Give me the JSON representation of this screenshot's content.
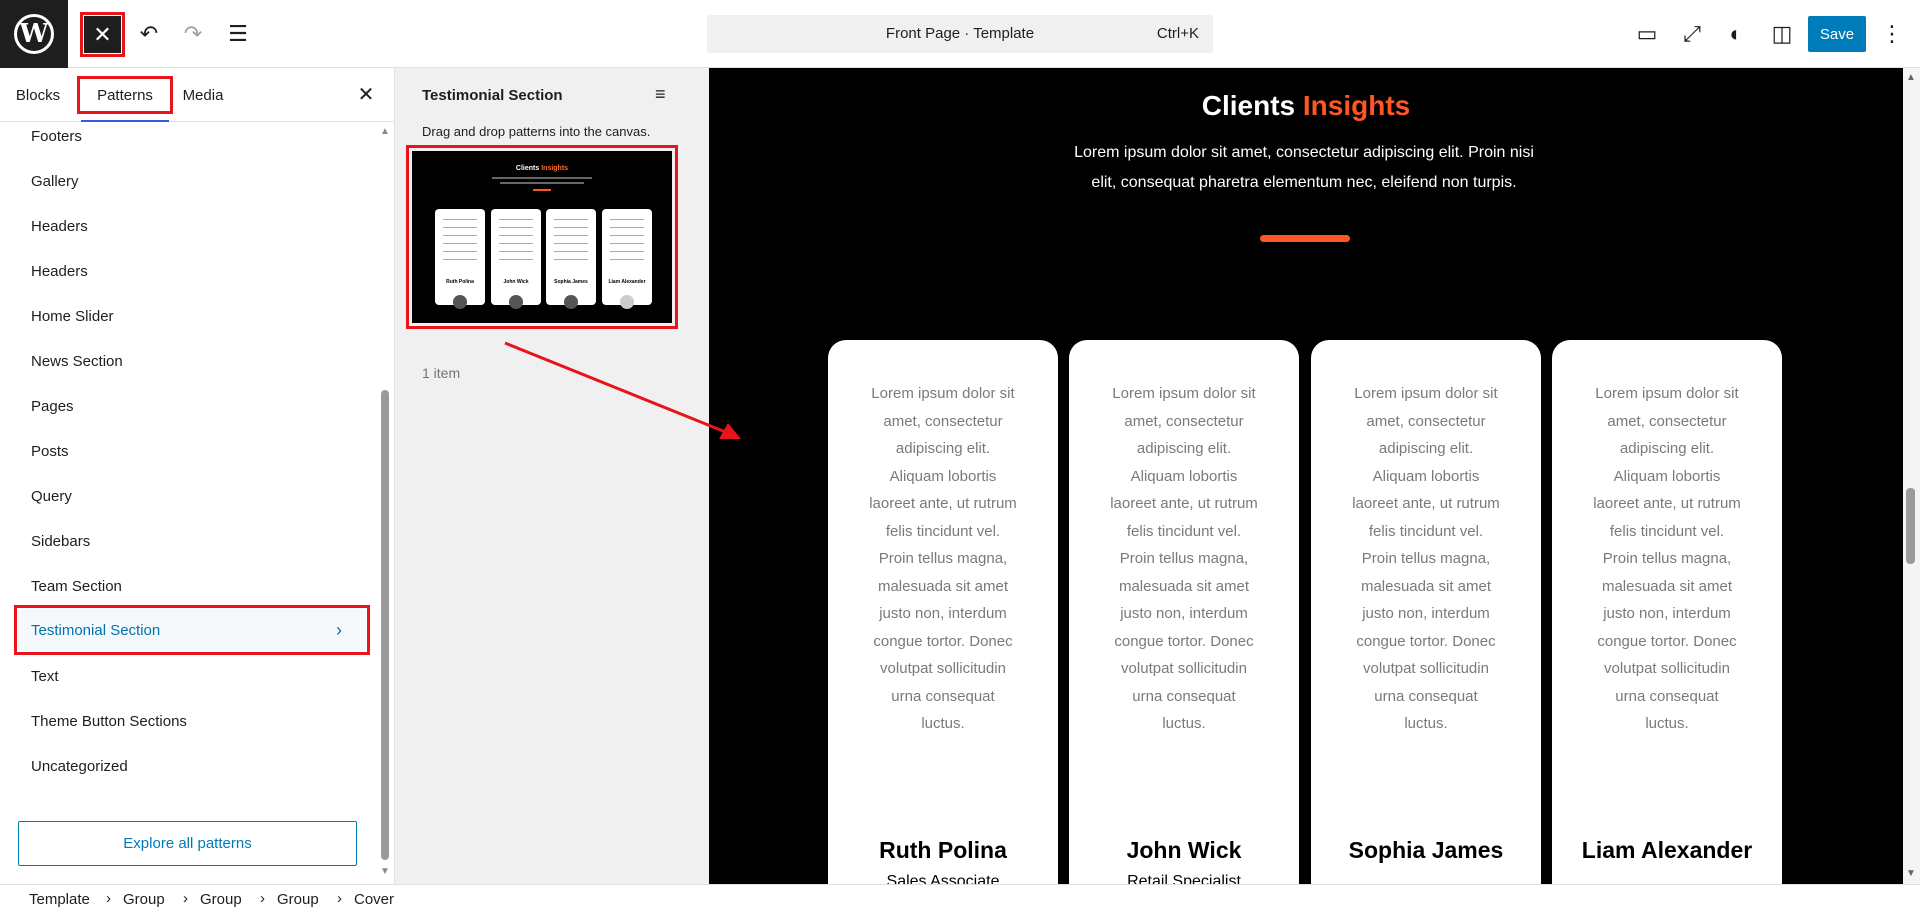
{
  "topbar": {
    "logo": "W",
    "close_glyph": "✕",
    "undo_glyph": "↶",
    "redo_glyph": "↷",
    "list_view_glyph": "☰",
    "document_title": "Front Page · Template",
    "shortcut": "Ctrl+K",
    "view_glyph": "▭",
    "fullscreen_glyph": "⤢",
    "styles_glyph": "◐",
    "settings_glyph": "◫",
    "save_label": "Save",
    "options_glyph": "⋮"
  },
  "inserter": {
    "tabs": [
      {
        "label": "Blocks"
      },
      {
        "label": "Patterns"
      },
      {
        "label": "Media"
      }
    ],
    "close_glyph": "✕",
    "categories": [
      "Footers",
      "Gallery",
      "Headers",
      "Headers",
      "Home Slider",
      "News Section",
      "Pages",
      "Posts",
      "Query",
      "Sidebars",
      "Team Section",
      "Testimonial Section",
      "Text",
      "Theme Button Sections",
      "Uncategorized"
    ],
    "selected_category_chevron": "›",
    "explore_label": "Explore all patterns"
  },
  "pattern_panel": {
    "title": "Testimonial Section",
    "filter_glyph": "≡",
    "hint": "Drag and drop patterns into the canvas.",
    "thumb_title_a": "Clients",
    "thumb_title_b": "Insights",
    "thumb_names": [
      "Ruth Polina",
      "John Wick",
      "Sophia James",
      "Liam Alexander"
    ],
    "count": "1 item"
  },
  "canvas": {
    "title_a": "Clients",
    "title_b": "Insights",
    "subtitle": "Lorem ipsum dolor sit amet, consectetur adipiscing elit. Proin nisi elit, consequat pharetra elementum nec, eleifend non turpis.",
    "cards": [
      {
        "quote": "Lorem ipsum dolor sit amet, consectetur adipiscing elit. Aliquam lobortis laoreet ante, ut rutrum felis tincidunt vel. Proin tellus magna, malesuada sit amet justo non, interdum congue tortor. Donec volutpat sollicitudin urna consequat luctus.",
        "name": "Ruth Polina",
        "role": "Sales Associate"
      },
      {
        "quote": "Lorem ipsum dolor sit amet, consectetur adipiscing elit. Aliquam lobortis laoreet ante, ut rutrum felis tincidunt vel. Proin tellus magna, malesuada sit amet justo non, interdum congue tortor. Donec volutpat sollicitudin urna consequat luctus.",
        "name": "John Wick",
        "role": "Retail Specialist"
      },
      {
        "quote": "Lorem ipsum dolor sit amet, consectetur adipiscing elit. Aliquam lobortis laoreet ante, ut rutrum felis tincidunt vel. Proin tellus magna, malesuada sit amet justo non, interdum congue tortor. Donec volutpat sollicitudin urna consequat luctus.",
        "name": "Sophia James",
        "role": ""
      },
      {
        "quote": "Lorem ipsum dolor sit amet, consectetur adipiscing elit. Aliquam lobortis laoreet ante, ut rutrum felis tincidunt vel. Proin tellus magna, malesuada sit amet justo non, interdum congue tortor. Donec volutpat sollicitudin urna consequat luctus.",
        "name": "Liam Alexander",
        "role": ""
      }
    ]
  },
  "breadcrumb": {
    "items": [
      "Template",
      "Group",
      "Group",
      "Group",
      "Cover"
    ],
    "separator": "›"
  },
  "colors": {
    "accent": "#ff5722",
    "highlight": "#e8141c",
    "primary": "#007cba"
  }
}
